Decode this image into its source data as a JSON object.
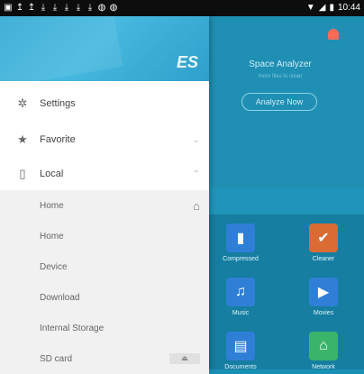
{
  "statusbar": {
    "time": "10:44"
  },
  "background_panel": {
    "space_analyzer_title": "Space Analyzer",
    "space_analyzer_subtitle": "more files to clean",
    "analyze_button": "Analyze Now",
    "tiles": [
      {
        "label": "Compressed",
        "icon": "zip-icon",
        "color": "#2f7fd6"
      },
      {
        "label": "Cleaner",
        "icon": "broom-icon",
        "color": "#d96b33"
      },
      {
        "label": "Music",
        "icon": "music-icon",
        "color": "#2f7fd6"
      },
      {
        "label": "Movies",
        "icon": "play-icon",
        "color": "#2f7fd6"
      },
      {
        "label": "Documents",
        "icon": "document-icon",
        "color": "#2f7fd6"
      },
      {
        "label": "Network",
        "icon": "network-icon",
        "color": "#39b56a"
      }
    ]
  },
  "drawer": {
    "logo": "ES",
    "settings": "Settings",
    "favorite": "Favorite",
    "local": "Local",
    "local_items": [
      "Home",
      "Home",
      "Device",
      "Download",
      "Internal Storage",
      "SD card"
    ]
  }
}
